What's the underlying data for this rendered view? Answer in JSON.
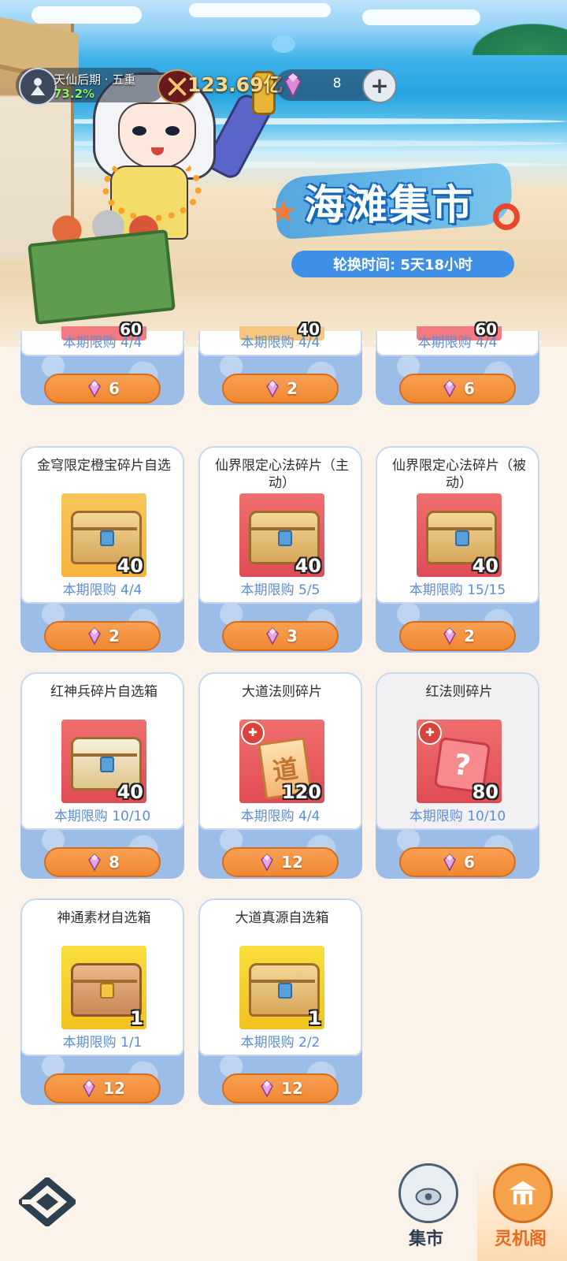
{
  "hud": {
    "realm": "天仙后期 · 五重",
    "realm_progress": "73.2%",
    "power": "123.69亿",
    "currency_amount": "8",
    "add_icon": "plus-icon"
  },
  "banner": {
    "title": "海滩集市",
    "rotation_label": "轮换时间: 5天18小时"
  },
  "partial_cards": [
    {
      "qty": "60",
      "limit": "本期限购 4/4",
      "price": "6",
      "bar_color": "#f27a80"
    },
    {
      "qty": "40",
      "limit": "本期限购 4/4",
      "price": "2",
      "bar_color": "#f6c57f"
    },
    {
      "qty": "60",
      "limit": "本期限购 4/4",
      "price": "6",
      "bar_color": "#f27a80"
    }
  ],
  "items": [
    {
      "name": "金穹限定橙宝碎片自选",
      "qty": "40",
      "limit": "本期限购 4/4",
      "price": "2",
      "bg": "gold",
      "icon": "treasure-chest-icon"
    },
    {
      "name": "仙界限定心法碎片（主动）",
      "qty": "40",
      "limit": "本期限购 5/5",
      "price": "3",
      "bg": "red",
      "icon": "treasure-chest-icon"
    },
    {
      "name": "仙界限定心法碎片（被动）",
      "qty": "40",
      "limit": "本期限购 15/15",
      "price": "2",
      "bg": "red",
      "icon": "treasure-chest-icon"
    },
    {
      "name": "红神兵碎片自选箱",
      "qty": "40",
      "limit": "本期限购 10/10",
      "price": "8",
      "bg": "red",
      "icon": "treasure-chest-icon"
    },
    {
      "name": "大道法则碎片",
      "qty": "120",
      "limit": "本期限购 4/4",
      "price": "12",
      "bg": "red",
      "icon": "dao-scroll-icon",
      "scroll_char": "道"
    },
    {
      "name": "红法则碎片",
      "qty": "80",
      "limit": "本期限购 10/10",
      "price": "6",
      "bg": "red",
      "icon": "mystery-fragment-icon"
    },
    {
      "name": "神通素材自选箱",
      "qty": "1",
      "limit": "本期限购 1/1",
      "price": "12",
      "bg": "yellow",
      "icon": "phoenix-chest-icon"
    },
    {
      "name": "大道真源自选箱",
      "qty": "1",
      "limit": "本期限购 2/2",
      "price": "12",
      "bg": "yellow",
      "icon": "treasure-chest-icon"
    }
  ],
  "nav": {
    "market_label": "集市",
    "lingji_label": "灵机阁"
  },
  "colors": {
    "accent_orange": "#f08832",
    "limit_blue": "#5b8ed4",
    "title_blue": "#3f8fe6"
  }
}
